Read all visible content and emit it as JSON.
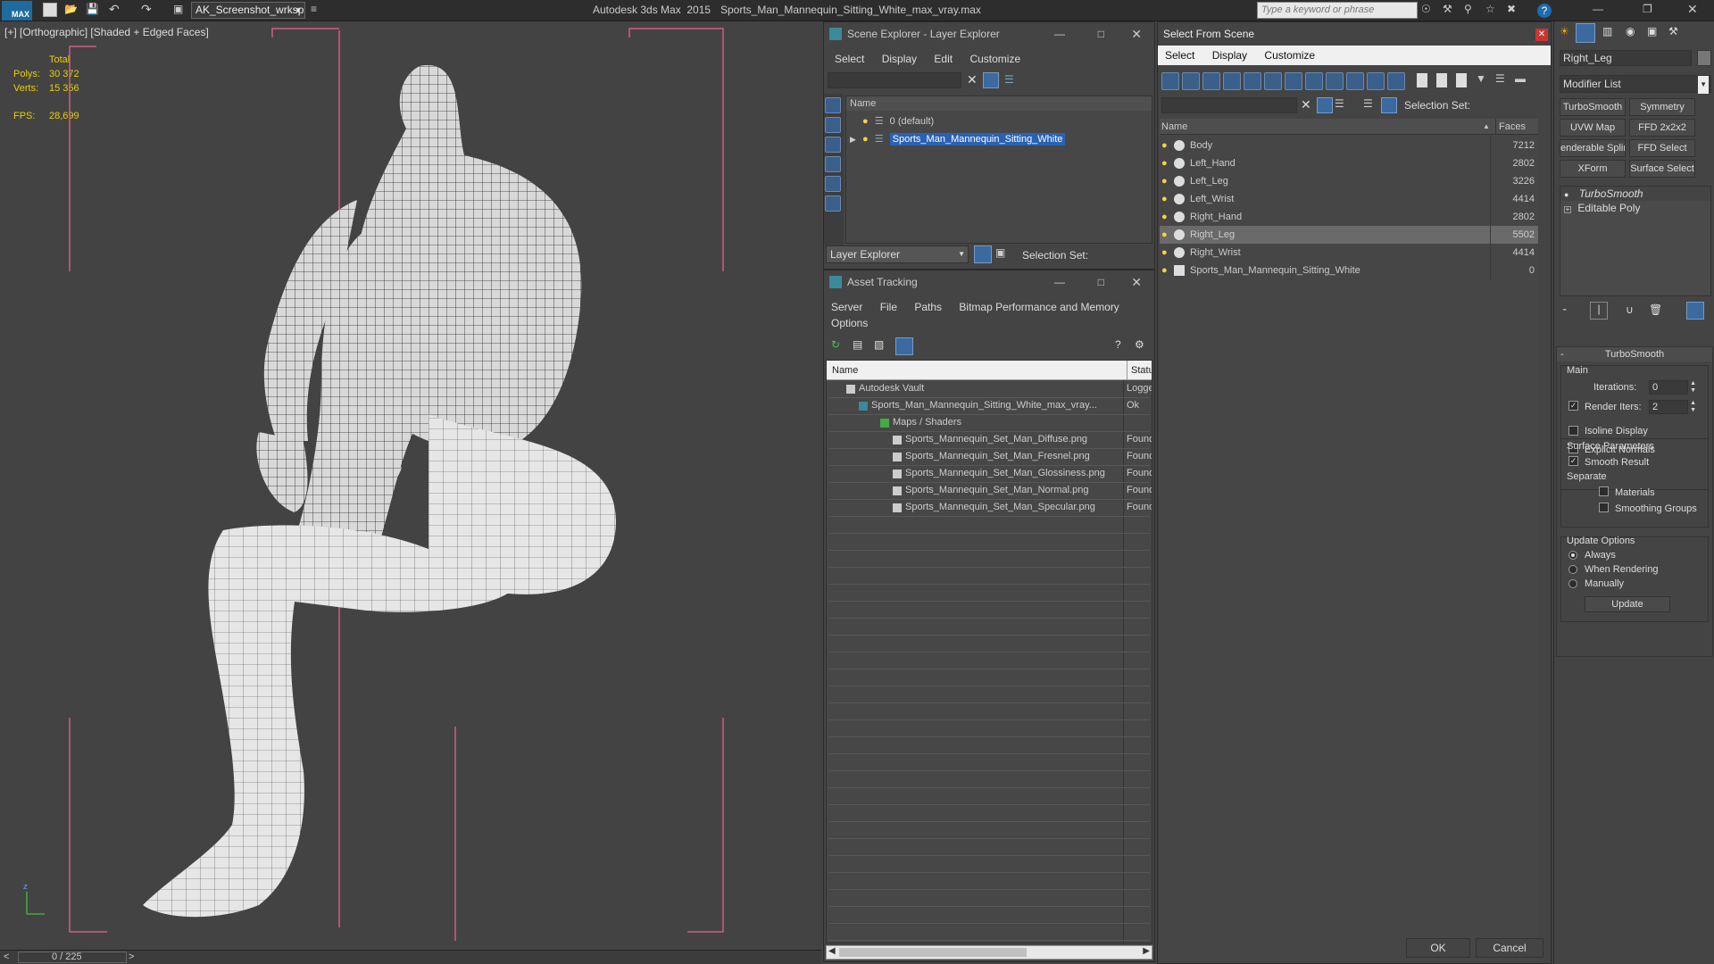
{
  "titlebar": {
    "app_title": "Autodesk 3ds Max  2015",
    "file_title": "Sports_Man_Mannequin_Sitting_White_max_vray.max",
    "workspace": "AK_Screenshot_wrksp",
    "search_placeholder": "Type a keyword or phrase"
  },
  "viewport": {
    "label": "[+] [Orthographic] [Shaded + Edged Faces]",
    "stats": {
      "total_label": "Total",
      "polys_label": "Polys:",
      "polys": "30 372",
      "verts_label": "Verts:",
      "verts": "15 356",
      "fps_label": "FPS:",
      "fps": "28,699"
    },
    "timeline": "0 / 225",
    "prev": "<",
    "next": ">"
  },
  "scene_explorer": {
    "title": "Scene Explorer - Layer Explorer",
    "menu": [
      "Select",
      "Display",
      "Edit",
      "Customize"
    ],
    "col_name": "Name",
    "layers": [
      {
        "name": "0 (default)"
      },
      {
        "name": "Sports_Man_Mannequin_Sitting_White"
      }
    ],
    "footer_dropdown": "Layer Explorer",
    "selection_set": "Selection Set:"
  },
  "asset_tracking": {
    "title": "Asset Tracking",
    "menu": [
      "Server",
      "File",
      "Paths",
      "Bitmap Performance and Memory"
    ],
    "menu2": "Options",
    "col_name": "Name",
    "col_status": "Status",
    "rows": [
      {
        "name": "Autodesk Vault",
        "status": "Logge"
      },
      {
        "name": "Sports_Man_Mannequin_Sitting_White_max_vray...",
        "status": "Ok"
      },
      {
        "name": "Maps / Shaders",
        "status": ""
      },
      {
        "name": "Sports_Mannequin_Set_Man_Diffuse.png",
        "status": "Found"
      },
      {
        "name": "Sports_Mannequin_Set_Man_Fresnel.png",
        "status": "Found"
      },
      {
        "name": "Sports_Mannequin_Set_Man_Glossiness.png",
        "status": "Found"
      },
      {
        "name": "Sports_Mannequin_Set_Man_Normal.png",
        "status": "Found"
      },
      {
        "name": "Sports_Mannequin_Set_Man_Specular.png",
        "status": "Found"
      }
    ]
  },
  "select_from_scene": {
    "title": "Select From Scene",
    "menu": [
      "Select",
      "Display",
      "Customize"
    ],
    "selection_set": "Selection Set:",
    "col_name": "Name",
    "col_faces": "Faces",
    "rows": [
      {
        "name": "Body",
        "faces": "7212"
      },
      {
        "name": "Left_Hand",
        "faces": "2802"
      },
      {
        "name": "Left_Leg",
        "faces": "3226"
      },
      {
        "name": "Left_Wrist",
        "faces": "4414"
      },
      {
        "name": "Right_Hand",
        "faces": "2802"
      },
      {
        "name": "Right_Leg",
        "faces": "5502"
      },
      {
        "name": "Right_Wrist",
        "faces": "4414"
      },
      {
        "name": "Sports_Man_Mannequin_Sitting_White",
        "faces": "0"
      }
    ],
    "ok": "OK",
    "cancel": "Cancel"
  },
  "command_panel": {
    "object_name": "Right_Leg",
    "modifier_list": "Modifier List",
    "buttons": [
      "TurboSmooth",
      "Symmetry",
      "UVW Map",
      "FFD 2x2x2",
      "enderable Splin",
      "FFD Select",
      "XForm",
      "Surface Select"
    ],
    "stack": [
      "TurboSmooth",
      "Editable Poly"
    ],
    "rollout_title": "TurboSmooth",
    "main": "Main",
    "iterations_label": "Iterations:",
    "iterations": "0",
    "render_iters_label": "Render Iters:",
    "render_iters": "2",
    "isoline": "Isoline Display",
    "explicit_normals": "Explicit Normals",
    "surface_params": "Surface Parameters",
    "smooth_result": "Smooth Result",
    "separate": "Separate",
    "materials": "Materials",
    "smoothing_groups": "Smoothing Groups",
    "update_options": "Update Options",
    "always": "Always",
    "when_rendering": "When Rendering",
    "manually": "Manually",
    "update": "Update"
  }
}
